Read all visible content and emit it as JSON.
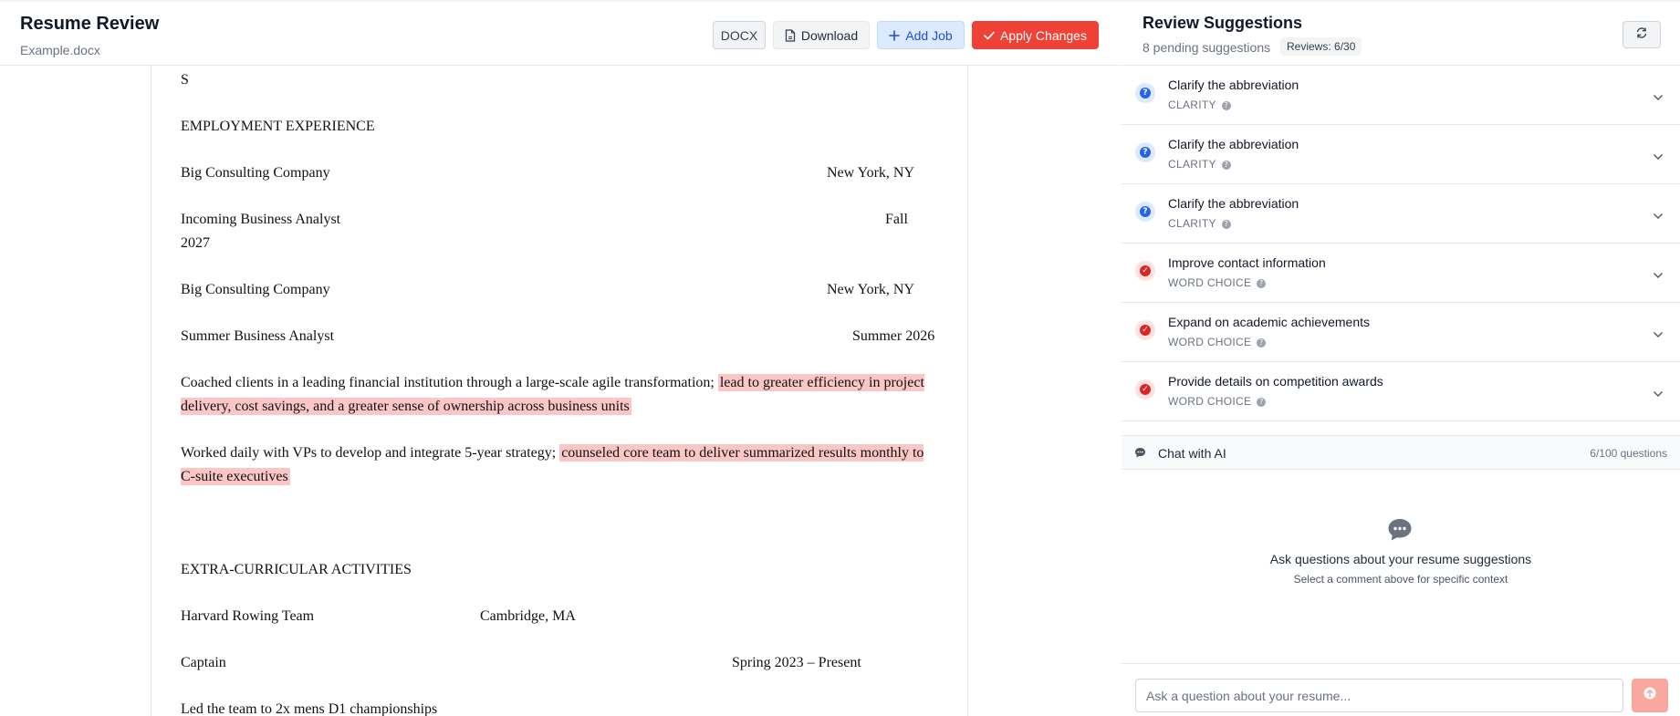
{
  "header": {
    "title": "Resume Review",
    "file_name": "Example.docx",
    "docx_label": "DOCX",
    "download_label": "Download",
    "add_job_label": "Add Job",
    "apply_label": "Apply Changes"
  },
  "document": {
    "partial_top": "S",
    "employment_heading": "EMPLOYMENT EXPERIENCE",
    "job1_company": "Big Consulting Company",
    "job1_location": "New York, NY",
    "job1_role": "Incoming Business Analyst",
    "job1_date_a": "Fall",
    "job1_date_b": "2027",
    "job2_company": "Big Consulting Company",
    "job2_location": "New York, NY",
    "job2_role": "Summer Business Analyst",
    "job2_date": "Summer 2026",
    "bullet1_plain": "Coached clients in a leading financial institution through a large-scale agile transformation; ",
    "bullet1_highlight": "lead to greater efficiency in project delivery, cost savings, and a greater sense of ownership across business units",
    "bullet2_plain": "Worked daily with VPs to develop and integrate 5-year strategy; ",
    "bullet2_highlight": "counseled core team to deliver summarized results monthly to C-suite executives",
    "extracurricular_heading": "EXTRA-CURRICULAR ACTIVITIES",
    "activity_org": "Harvard Rowing Team",
    "activity_location": "Cambridge, MA",
    "activity_role": "Captain",
    "activity_date": "Spring 2023 – Present",
    "activity_bullet": "Led the team to 2x mens D1 championships"
  },
  "review": {
    "title": "Review Suggestions",
    "pending": "8 pending suggestions",
    "reviews_badge": "Reviews: 6/30",
    "suggestions": [
      {
        "title": "Clarify the abbreviation",
        "category": "CLARITY"
      },
      {
        "title": "Clarify the abbreviation",
        "category": "CLARITY"
      },
      {
        "title": "Clarify the abbreviation",
        "category": "CLARITY"
      },
      {
        "title": "Improve contact information",
        "category": "WORD CHOICE"
      },
      {
        "title": "Expand on academic achievements",
        "category": "WORD CHOICE"
      },
      {
        "title": "Provide details on competition awards",
        "category": "WORD CHOICE"
      }
    ]
  },
  "chat": {
    "title": "Chat with AI",
    "count": "6/100 questions",
    "empty_title": "Ask questions about your resume suggestions",
    "empty_subtitle": "Select a comment above for specific context",
    "input_placeholder": "Ask a question about your resume..."
  },
  "colors": {
    "accent_red": "#ef4136",
    "accent_blue": "#1d4ed8",
    "highlight": "#fbc6c6",
    "clarity_icon": "#2563eb",
    "word_choice_icon": "#dc2626"
  },
  "icons": {
    "download": "file-icon",
    "add_job": "plus-icon",
    "apply": "check-icon",
    "refresh": "refresh-icon",
    "clarity": "question-circle-icon",
    "word_choice": "check-circle-icon",
    "expand": "chevron-down-icon",
    "chat": "chat-bubble-icon",
    "send": "send-arrow-icon"
  }
}
